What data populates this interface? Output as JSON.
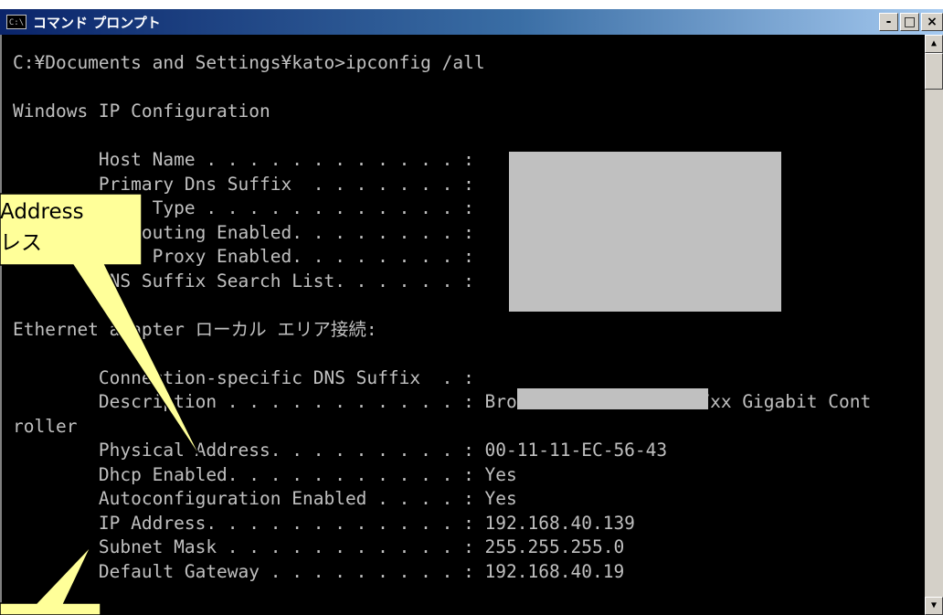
{
  "window": {
    "title": "コマンド プロンプト",
    "icon_label": "C:\\",
    "buttons": {
      "minimize": "-",
      "maximize": "□",
      "close": "×"
    }
  },
  "console": {
    "lines": [
      "C:¥Documents and Settings¥kato>ipconfig /all",
      "",
      "Windows IP Configuration",
      "",
      "        Host Name . . . . . . . . . . . . :",
      "        Primary Dns Suffix  . . . . . . . :",
      "        Node Type . . . . . . . . . . . . :",
      "        IP Routing Enabled. . . . . . . . :",
      "        WINS Proxy Enabled. . . . . . . . :",
      "        DNS Suffix Search List. . . . . . :",
      "",
      "Ethernet adapter ローカル エリア接続:",
      "",
      "        Connection-specific DNS Suffix  . :",
      "        Description . . . . . . . . . . . : Broadcom NetXtreme 57xx Gigabit Cont",
      "roller",
      "        Physical Address. . . . . . . . . : 00-11-11-EC-56-43",
      "        Dhcp Enabled. . . . . . . . . . . : Yes",
      "        Autoconfiguration Enabled . . . . : Yes",
      "        IP Address. . . . . . . . . . . . : 192.168.40.139",
      "        Subnet Mask . . . . . . . . . . . : 255.255.255.0",
      "        Default Gateway . . . . . . . . . : 192.168.40.19"
    ]
  },
  "callouts": {
    "mac": {
      "line1": "Address",
      "line2": "レス"
    }
  },
  "colors": {
    "console_bg": "#000000",
    "console_text": "#c0c0c0",
    "callout": "#ffff99",
    "redaction": "#c0c0c0"
  }
}
